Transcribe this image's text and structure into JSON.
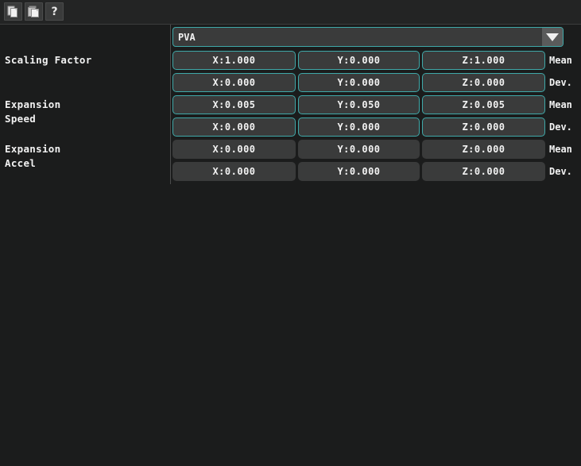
{
  "toolbar": {
    "buttons": [
      {
        "name": "copy-icon",
        "tooltip": "Copy"
      },
      {
        "name": "paste-icon",
        "tooltip": "Paste"
      },
      {
        "name": "help-icon",
        "label": "?"
      }
    ]
  },
  "selector": {
    "value": "PVA",
    "arrow": "dropdown-arrow"
  },
  "groups": [
    {
      "label": "Scaling Factor"
    },
    {
      "label": "Expansion\nSpeed"
    },
    {
      "label": "Expansion\nAccel"
    }
  ],
  "rows": [
    {
      "x": "X:1.000",
      "y": "Y:0.000",
      "z": "Z:1.000",
      "stat": "Mean",
      "enabled": true
    },
    {
      "x": "X:0.000",
      "y": "Y:0.000",
      "z": "Z:0.000",
      "stat": "Dev.",
      "enabled": true
    },
    {
      "x": "X:0.005",
      "y": "Y:0.050",
      "z": "Z:0.005",
      "stat": "Mean",
      "enabled": true
    },
    {
      "x": "X:0.000",
      "y": "Y:0.000",
      "z": "Z:0.000",
      "stat": "Dev.",
      "enabled": true
    },
    {
      "x": "X:0.000",
      "y": "Y:0.000",
      "z": "Z:0.000",
      "stat": "Mean",
      "enabled": false
    },
    {
      "x": "X:0.000",
      "y": "Y:0.000",
      "z": "Z:0.000",
      "stat": "Dev.",
      "enabled": false
    }
  ],
  "colors": {
    "background": "#1b1c1c",
    "toolbar": "#232424",
    "field_fill": "#3a3b3b",
    "accent_teal": "#3fa8a8",
    "text": "#f2f2f2",
    "separator": "#4b4c4c"
  }
}
